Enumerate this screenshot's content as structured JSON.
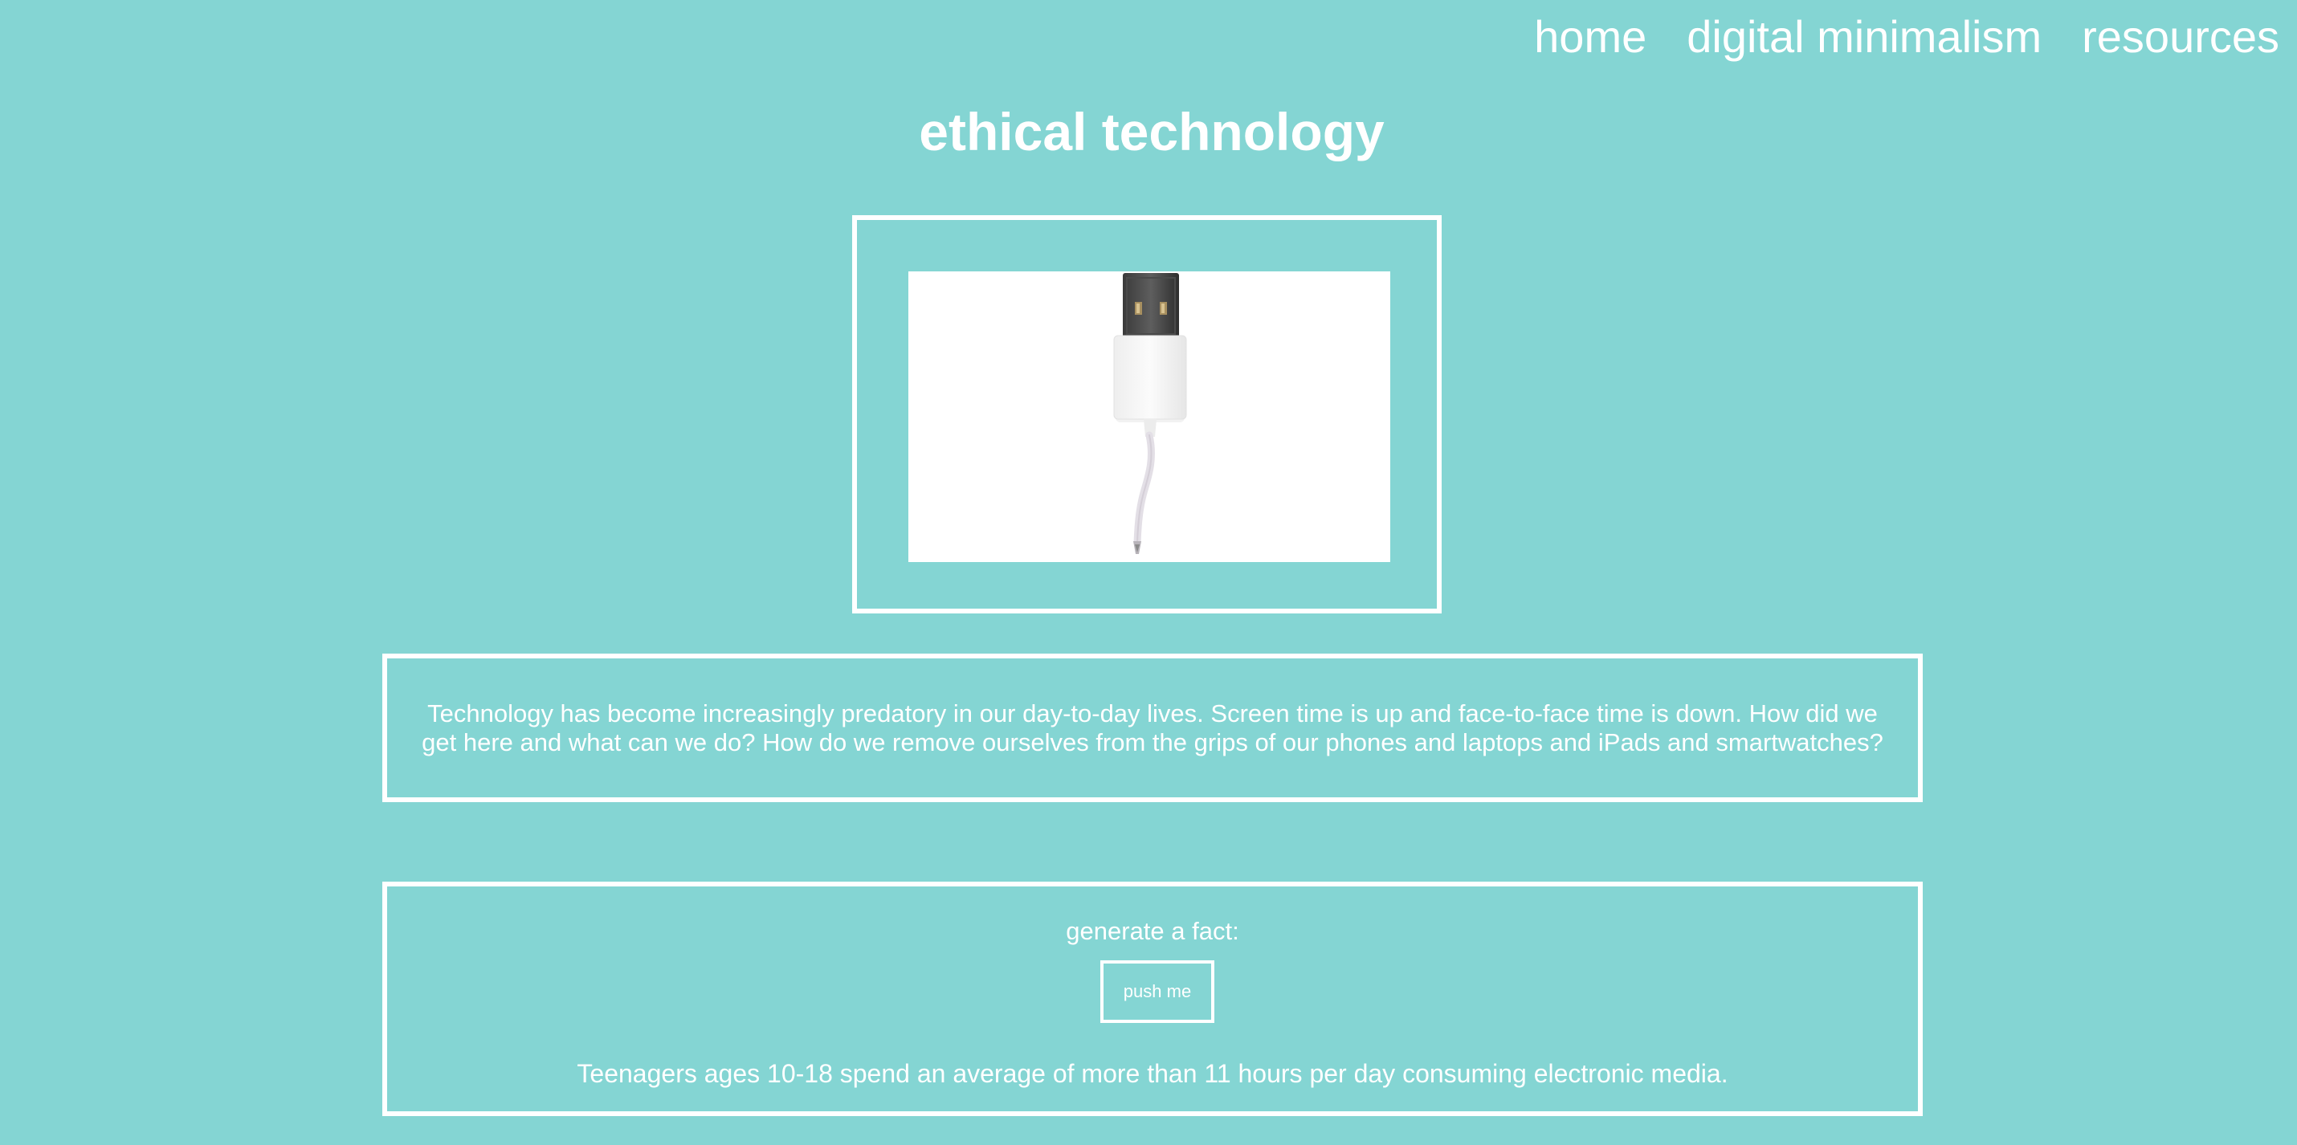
{
  "nav": {
    "items": [
      {
        "label": "home"
      },
      {
        "label": "digital minimalism"
      },
      {
        "label": "resources"
      }
    ]
  },
  "page": {
    "title": "ethical technology"
  },
  "intro": {
    "text": "Technology has become increasingly predatory in our day-to-day lives. Screen time is up and face-to-face time is down. How did we get here and what can we do? How do we remove ourselves from the grips of our phones and laptops and iPads and smartwatches?"
  },
  "fact": {
    "label": "generate a fact:",
    "button_label": "push me",
    "text": "Teenagers ages 10-18 spend an average of more than 11 hours per day consuming electronic media."
  },
  "colors": {
    "background": "#84d5d3",
    "foreground": "#ffffff"
  }
}
